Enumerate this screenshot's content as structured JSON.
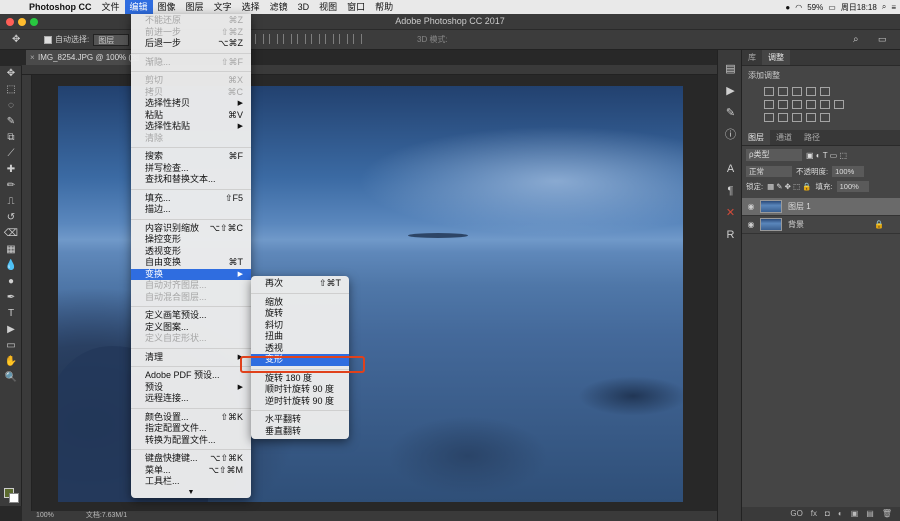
{
  "mac_menubar": {
    "app": "Photoshop CC",
    "items": [
      "文件",
      "编辑",
      "图像",
      "图层",
      "文字",
      "选择",
      "滤镜",
      "3D",
      "视图",
      "窗口",
      "帮助"
    ],
    "active_index": 1,
    "battery": "59%",
    "clock": "周日18:18"
  },
  "window": {
    "title": "Adobe Photoshop CC 2017"
  },
  "options_bar": {
    "auto_select_label": "自动选择:",
    "auto_select_value": "图层",
    "mode_3d_label": "3D 模式:"
  },
  "doc_tab": {
    "title": "IMG_8254.JPG @ 100% (图"
  },
  "status_bar": {
    "zoom": "100%",
    "doc_info": "文档:7.63M/1"
  },
  "tools": [
    "move-tool",
    "marquee-tool",
    "lasso-tool",
    "quick-select-tool",
    "crop-tool",
    "eyedropper-tool",
    "healing-tool",
    "brush-tool",
    "stamp-tool",
    "history-brush-tool",
    "eraser-tool",
    "gradient-tool",
    "blur-tool",
    "dodge-tool",
    "pen-tool",
    "type-tool",
    "path-select-tool",
    "shape-tool",
    "hand-tool",
    "zoom-tool"
  ],
  "tool_glyphs": [
    "✥",
    "⬚",
    "◌",
    "✎",
    "⧉",
    "⟋",
    "✚",
    "✏",
    "⎍",
    "↺",
    "⌫",
    "▦",
    "💧",
    "●",
    "✒",
    "T",
    "▶",
    "▭",
    "✋",
    "🔍"
  ],
  "edit_menu": {
    "groups": [
      [
        {
          "label": "不能还原",
          "shortcut": "⌘Z",
          "disabled": true
        },
        {
          "label": "前进一步",
          "shortcut": "⇧⌘Z",
          "disabled": true
        },
        {
          "label": "后退一步",
          "shortcut": "⌥⌘Z",
          "disabled": false
        }
      ],
      [
        {
          "label": "渐隐...",
          "shortcut": "⇧⌘F",
          "disabled": true
        }
      ],
      [
        {
          "label": "剪切",
          "shortcut": "⌘X",
          "disabled": true
        },
        {
          "label": "拷贝",
          "shortcut": "⌘C",
          "disabled": true
        },
        {
          "label": "选择性拷贝",
          "shortcut": "▶",
          "disabled": false
        },
        {
          "label": "粘贴",
          "shortcut": "⌘V",
          "disabled": false
        },
        {
          "label": "选择性粘贴",
          "shortcut": "▶",
          "disabled": false
        },
        {
          "label": "清除",
          "shortcut": "",
          "disabled": true
        }
      ],
      [
        {
          "label": "搜索",
          "shortcut": "⌘F",
          "disabled": false
        },
        {
          "label": "拼写检查...",
          "shortcut": "",
          "disabled": false
        },
        {
          "label": "查找和替换文本...",
          "shortcut": "",
          "disabled": false
        }
      ],
      [
        {
          "label": "填充...",
          "shortcut": "⇧F5",
          "disabled": false
        },
        {
          "label": "描边...",
          "shortcut": "",
          "disabled": false
        }
      ],
      [
        {
          "label": "内容识别缩放",
          "shortcut": "⌥⇧⌘C",
          "disabled": false
        },
        {
          "label": "操控变形",
          "shortcut": "",
          "disabled": false
        },
        {
          "label": "透视变形",
          "shortcut": "",
          "disabled": false
        },
        {
          "label": "自由变换",
          "shortcut": "⌘T",
          "disabled": false
        },
        {
          "label": "变换",
          "shortcut": "▶",
          "disabled": false,
          "highlighted": true
        },
        {
          "label": "自动对齐图层...",
          "shortcut": "",
          "disabled": true
        },
        {
          "label": "自动混合图层...",
          "shortcut": "",
          "disabled": true
        }
      ],
      [
        {
          "label": "定义画笔预设...",
          "shortcut": "",
          "disabled": false
        },
        {
          "label": "定义图案...",
          "shortcut": "",
          "disabled": false
        },
        {
          "label": "定义自定形状...",
          "shortcut": "",
          "disabled": true
        }
      ],
      [
        {
          "label": "清理",
          "shortcut": "▶",
          "disabled": false
        }
      ],
      [
        {
          "label": "Adobe PDF 预设...",
          "shortcut": "",
          "disabled": false
        },
        {
          "label": "预设",
          "shortcut": "▶",
          "disabled": false
        },
        {
          "label": "远程连接...",
          "shortcut": "",
          "disabled": false
        }
      ],
      [
        {
          "label": "颜色设置...",
          "shortcut": "⇧⌘K",
          "disabled": false
        },
        {
          "label": "指定配置文件...",
          "shortcut": "",
          "disabled": false
        },
        {
          "label": "转换为配置文件...",
          "shortcut": "",
          "disabled": false
        }
      ],
      [
        {
          "label": "键盘快捷键...",
          "shortcut": "⌥⇧⌘K",
          "disabled": false
        },
        {
          "label": "菜单...",
          "shortcut": "⌥⇧⌘M",
          "disabled": false
        },
        {
          "label": "工具栏...",
          "shortcut": "",
          "disabled": false
        }
      ]
    ],
    "more_glyph": "▼"
  },
  "transform_submenu": {
    "groups": [
      [
        {
          "label": "再次",
          "shortcut": "⇧⌘T"
        }
      ],
      [
        {
          "label": "缩放"
        },
        {
          "label": "旋转"
        },
        {
          "label": "斜切"
        },
        {
          "label": "扭曲"
        },
        {
          "label": "透视"
        },
        {
          "label": "变形",
          "highlighted": true
        }
      ],
      [
        {
          "label": "旋转 180 度"
        },
        {
          "label": "顺时针旋转 90 度"
        },
        {
          "label": "逆时针旋转 90 度"
        }
      ],
      [
        {
          "label": "水平翻转"
        },
        {
          "label": "垂直翻转"
        }
      ]
    ]
  },
  "right_panels": {
    "top_tabs": [
      "库",
      "调整"
    ],
    "adjust_title": "添加调整",
    "layer_tabs": [
      "图层",
      "通道",
      "路径"
    ],
    "filter_label": "ρ类型",
    "blend_mode": "正常",
    "opacity_label": "不透明度:",
    "opacity_value": "100%",
    "lock_label": "锁定:",
    "fill_label": "填充:",
    "fill_value": "100%",
    "layers": [
      {
        "name": "图层 1",
        "selected": true
      },
      {
        "name": "背景",
        "selected": false,
        "locked": true
      }
    ],
    "footer_icons": [
      "GO",
      "fx",
      "◘",
      "◐",
      "▣",
      "▤",
      "🗑"
    ]
  },
  "colors": {
    "accent": "#2f6de0",
    "highlight_box": "#e0411b",
    "foreground": "#5b6a2e"
  }
}
